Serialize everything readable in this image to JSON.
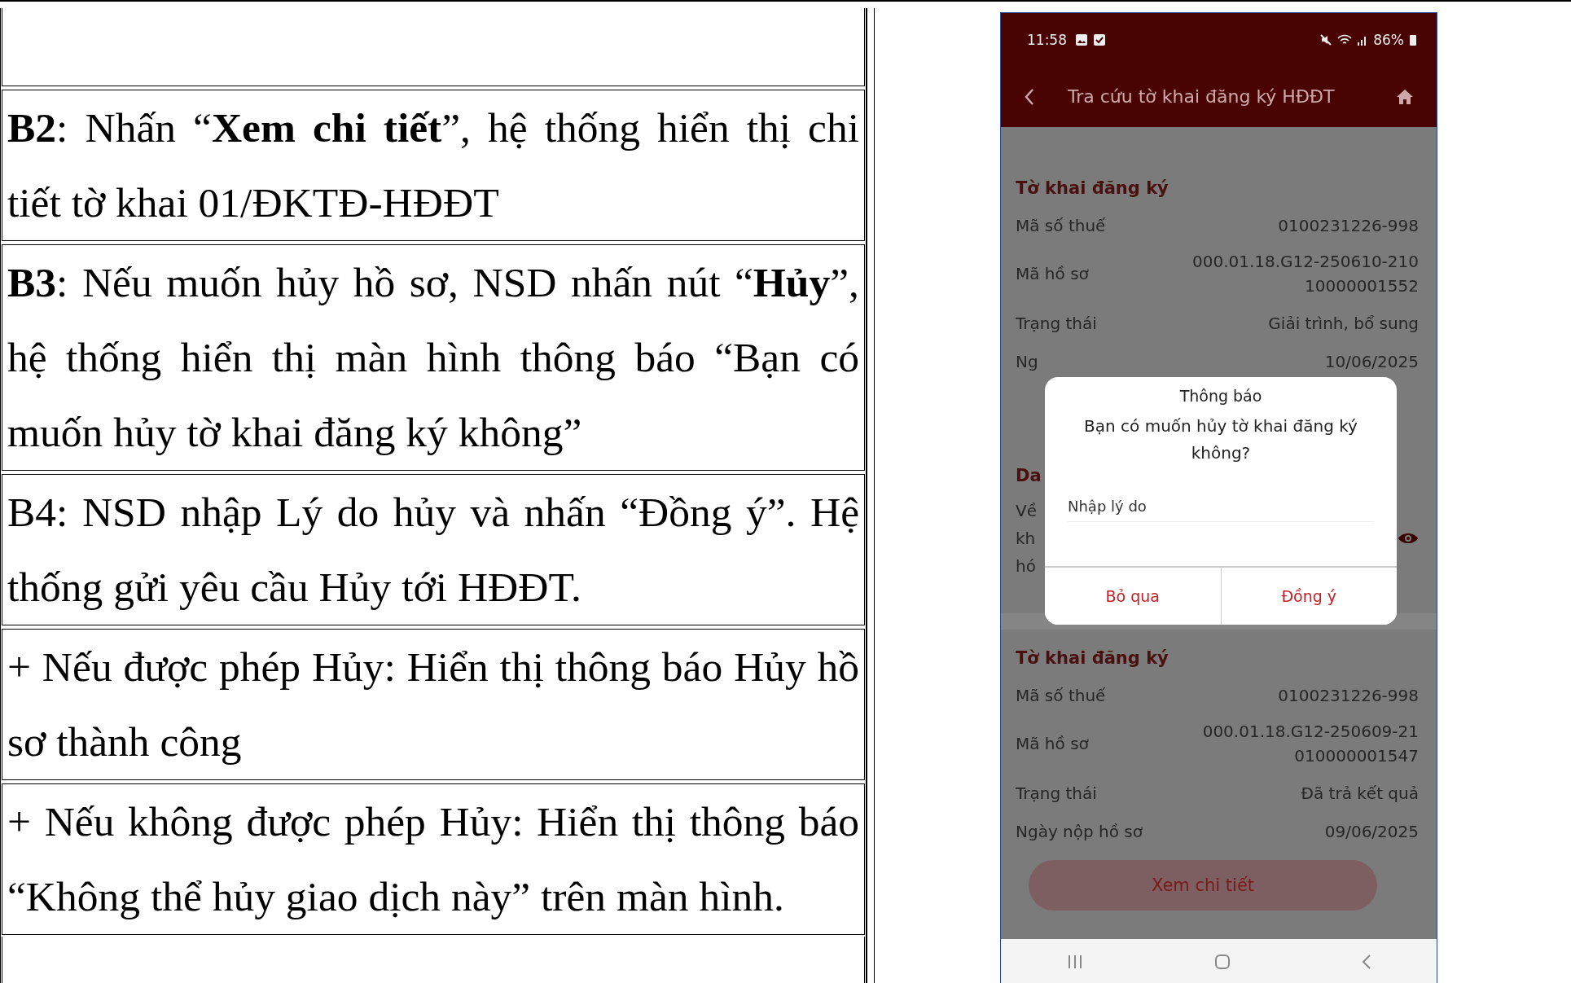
{
  "document": {
    "steps": [
      {
        "text": "**B2**: Nhấn “**Xem chi tiết**”, hệ thống hiển thị chi tiết tờ khai 01/ĐKTĐ-HĐĐT"
      },
      {
        "text": "**B3**: Nếu muốn hủy hồ sơ, NSD nhấn nút “**Hủy**”, hệ thống hiển thị màn hình thông báo “Bạn có muốn hủy tờ khai đăng ký không”"
      },
      {
        "text": "B4: NSD nhập Lý do hủy và nhấn “Đồng ý”. Hệ thống gửi yêu cầu Hủy tới HĐĐT."
      },
      {
        "text": "+ Nếu được phép Hủy: Hiển thị thông báo Hủy hồ sơ thành công"
      },
      {
        "text": "+ Nếu không được phép Hủy: Hiển thị thông báo “Không thể hủy giao dịch này” trên màn hình."
      }
    ]
  },
  "phone": {
    "status_bar": {
      "time": "11:58",
      "battery": "86%"
    },
    "app_bar": {
      "title": "Tra cứu tờ khai đăng ký HĐĐT"
    },
    "sections": [
      {
        "title": "Tờ khai đăng ký",
        "fields": [
          {
            "label": "Mã số thuế",
            "value_lines": [
              "0100231226-998"
            ]
          },
          {
            "label": "Mã hồ sơ",
            "value_lines": [
              "000.01.18.G12-250610-210",
              "10000001552"
            ]
          },
          {
            "label": "Trạng thái",
            "value_lines": [
              "Giải trình, bổ sung"
            ]
          },
          {
            "label": "Ng",
            "value_lines": [
              "10/06/2025"
            ]
          }
        ]
      },
      {
        "title": "Tờ khai đăng ký",
        "fields": [
          {
            "label": "Mã số thuế",
            "value_lines": [
              "0100231226-998"
            ]
          },
          {
            "label": "Mã hồ sơ",
            "value_lines": [
              "000.01.18.G12-250609-21",
              "010000001547"
            ]
          },
          {
            "label": "Trạng thái",
            "value_lines": [
              "Đã trả kết quả"
            ]
          },
          {
            "label": "Ngày nộp hồ sơ",
            "value_lines": [
              "09/06/2025"
            ]
          }
        ],
        "button": "Xem chi tiết"
      }
    ],
    "covered": {
      "title": "Da",
      "lines": [
        "Về",
        "kh",
        "hó"
      ]
    },
    "dialog": {
      "title": "Thông báo",
      "message": "Bạn có muốn hủy tờ khai đăng ký không?",
      "input": {
        "placeholder": "Nhập lý do"
      },
      "buttons": [
        "Bỏ qua",
        "Đồng ý"
      ]
    }
  }
}
